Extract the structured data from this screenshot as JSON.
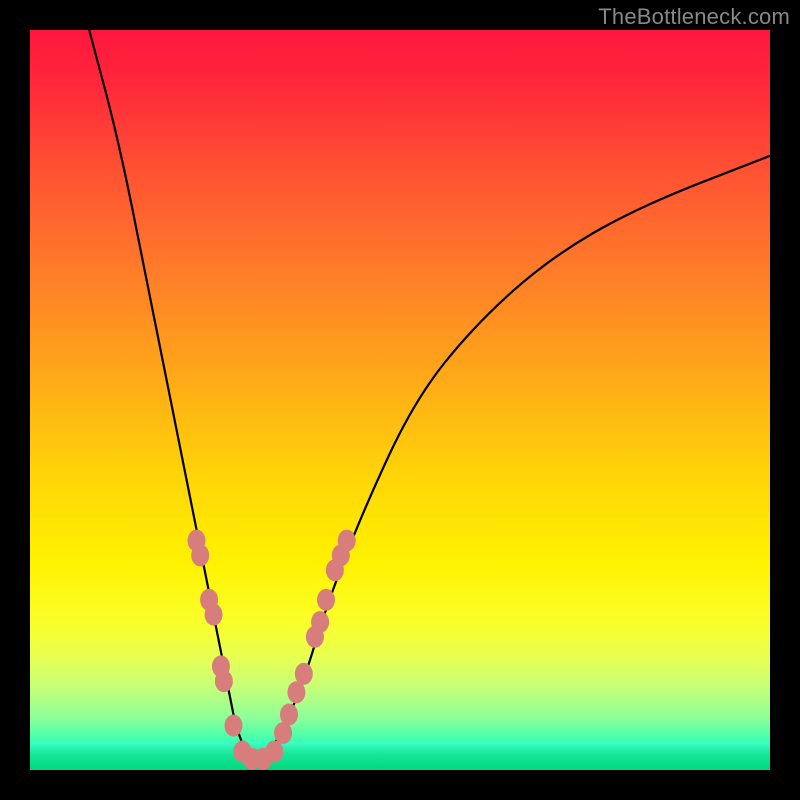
{
  "watermark": "TheBottleneck.com",
  "colors": {
    "background": "#000000",
    "curve_stroke": "#000000",
    "marker_fill": "#d77d7b",
    "marker_stroke": "#d77d7b",
    "watermark_text": "#888888"
  },
  "chart_data": {
    "type": "line",
    "title": "",
    "xlabel": "",
    "ylabel": "",
    "xlim": [
      0,
      100
    ],
    "ylim": [
      0,
      100
    ],
    "grid": false,
    "legend": false,
    "curve_comment": "V-shaped bottleneck curve; minimum near x≈30; left branch steep, right branch asymptotic",
    "curve_points": [
      {
        "x": 8,
        "y": 100
      },
      {
        "x": 12,
        "y": 85
      },
      {
        "x": 16,
        "y": 65
      },
      {
        "x": 20,
        "y": 45
      },
      {
        "x": 23,
        "y": 30
      },
      {
        "x": 25,
        "y": 20
      },
      {
        "x": 27,
        "y": 10
      },
      {
        "x": 28,
        "y": 5
      },
      {
        "x": 30,
        "y": 1
      },
      {
        "x": 32,
        "y": 2
      },
      {
        "x": 34,
        "y": 5
      },
      {
        "x": 37,
        "y": 12
      },
      {
        "x": 40,
        "y": 22
      },
      {
        "x": 45,
        "y": 35
      },
      {
        "x": 52,
        "y": 50
      },
      {
        "x": 60,
        "y": 60
      },
      {
        "x": 70,
        "y": 69
      },
      {
        "x": 82,
        "y": 76
      },
      {
        "x": 100,
        "y": 83
      }
    ],
    "markers_comment": "pink dot markers clustered near curve trough",
    "markers": [
      {
        "x": 22.5,
        "y": 31
      },
      {
        "x": 23.0,
        "y": 29
      },
      {
        "x": 24.2,
        "y": 23
      },
      {
        "x": 24.8,
        "y": 21
      },
      {
        "x": 25.8,
        "y": 14
      },
      {
        "x": 26.2,
        "y": 12
      },
      {
        "x": 27.5,
        "y": 6
      },
      {
        "x": 28.7,
        "y": 2.5
      },
      {
        "x": 30.0,
        "y": 1.5
      },
      {
        "x": 31.5,
        "y": 1.5
      },
      {
        "x": 33.0,
        "y": 2.5
      },
      {
        "x": 34.2,
        "y": 5
      },
      {
        "x": 35.0,
        "y": 7.5
      },
      {
        "x": 36.0,
        "y": 10.5
      },
      {
        "x": 37.0,
        "y": 13
      },
      {
        "x": 38.5,
        "y": 18
      },
      {
        "x": 39.2,
        "y": 20
      },
      {
        "x": 40.0,
        "y": 23
      },
      {
        "x": 41.2,
        "y": 27
      },
      {
        "x": 42.0,
        "y": 29
      },
      {
        "x": 42.8,
        "y": 31
      }
    ]
  }
}
